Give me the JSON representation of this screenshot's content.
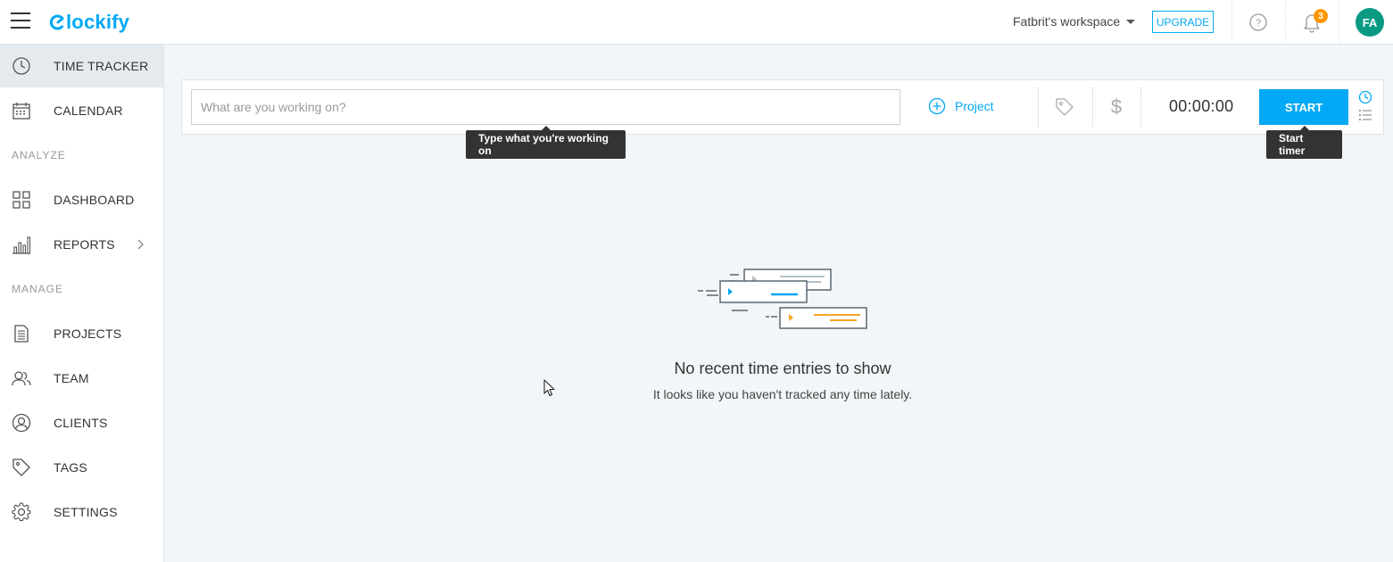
{
  "app": {
    "name": "Clockify"
  },
  "header": {
    "workspace": "Fatbrit's workspace",
    "upgrade_label": "UPGRADE",
    "notification_count": "3",
    "avatar_initials": "FA",
    "colors": {
      "accent": "#03a9f4",
      "badge": "#ff9800",
      "avatar": "#0a9a83"
    }
  },
  "sidebar": {
    "items": [
      {
        "label": "TIME TRACKER",
        "icon": "clock-icon",
        "active": true
      },
      {
        "label": "CALENDAR",
        "icon": "calendar-icon"
      },
      {
        "label": "DASHBOARD",
        "icon": "dashboard-grid-icon"
      },
      {
        "label": "REPORTS",
        "icon": "bar-chart-icon"
      },
      {
        "label": "PROJECTS",
        "icon": "document-icon"
      },
      {
        "label": "TEAM",
        "icon": "people-icon"
      },
      {
        "label": "CLIENTS",
        "icon": "person-circle-icon"
      },
      {
        "label": "TAGS",
        "icon": "tag-icon"
      },
      {
        "label": "SETTINGS",
        "icon": "gear-icon"
      }
    ],
    "sections": {
      "analyze": "ANALYZE",
      "manage": "MANAGE"
    }
  },
  "tracker": {
    "description_placeholder": "What are you working on?",
    "description_value": "",
    "project_label": "Project",
    "timer": "00:00:00",
    "start_label": "START"
  },
  "tooltips": {
    "description": "Type what you're working on",
    "start": "Start timer"
  },
  "empty_state": {
    "title": "No recent time entries to show",
    "subtitle": "It looks like you haven't tracked any time lately."
  }
}
